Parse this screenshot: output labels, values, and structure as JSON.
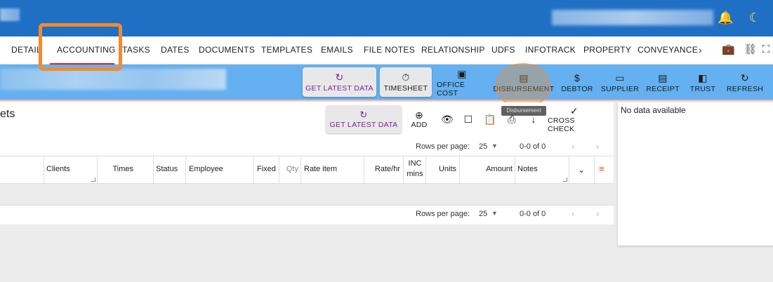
{
  "tabs": [
    {
      "label": "DETAIL"
    },
    {
      "label": "ACCOUNTING"
    },
    {
      "label": "TASKS"
    },
    {
      "label": "DATES"
    },
    {
      "label": "DOCUMENTS"
    },
    {
      "label": "TEMPLATES"
    },
    {
      "label": "EMAILS"
    },
    {
      "label": "FILE NOTES"
    },
    {
      "label": "RELATIONSHIP"
    },
    {
      "label": "UDFS"
    },
    {
      "label": "INFOTRACK"
    },
    {
      "label": "PROPERTY"
    },
    {
      "label": "CONVEYANCE"
    }
  ],
  "tabs_more": "›",
  "actions": {
    "get_latest": "GET LATEST DATA",
    "timesheet": "TIMESHEET",
    "office_cost": "OFFICE COST",
    "disbursement": "DISBURSEMENT",
    "debtor": "DEBTOR",
    "supplier": "SUPPLIER",
    "receipt": "RECEIPT",
    "trust": "TRUST",
    "refresh": "REFRESH"
  },
  "tooltip": "Disbursement",
  "panel": {
    "title": "ets",
    "get_latest": "GET LATEST DATA",
    "add": "ADD",
    "cross_check": "CROSS CHECK"
  },
  "pager": {
    "label": "Rows per page:",
    "value": "25",
    "range": "0-0 of 0"
  },
  "columns": [
    "Clients",
    "Times",
    "Status",
    "Employee",
    "Fixed",
    "Qty",
    "Rate item",
    "Rate/hr",
    "INC mins",
    "Units",
    "Amount",
    "Notes"
  ],
  "side_panel": {
    "empty_text": "No data available"
  },
  "colors": {
    "appbar": "#1f6fc5",
    "actionbar": "#64b0f0",
    "accent": "#7b1fa2",
    "highlight": "#f28b2c"
  }
}
